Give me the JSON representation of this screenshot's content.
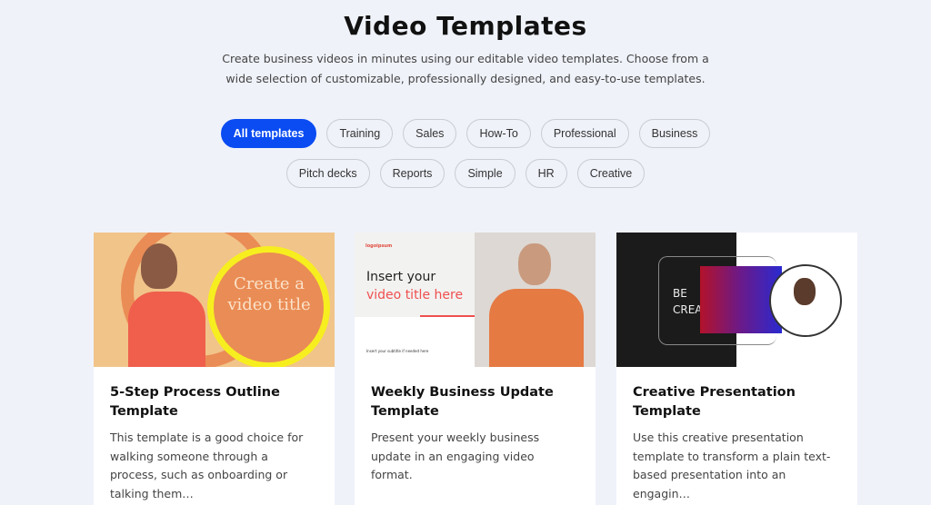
{
  "header": {
    "title": "Video Templates",
    "subtitle": "Create business videos in minutes using our editable video templates. Choose from a wide selection of customizable, professionally designed, and easy-to-use templates."
  },
  "filters": {
    "row1": [
      "All templates",
      "Training",
      "Sales",
      "How-To",
      "Professional",
      "Business"
    ],
    "row2": [
      "Pitch decks",
      "Reports",
      "Simple",
      "HR",
      "Creative"
    ],
    "active": "All templates"
  },
  "cards": [
    {
      "title": "5-Step Process Outline Template",
      "description": "This template is a good choice for walking someone through a process, such as onboarding or talking them…",
      "thumb_text": "Create a video title"
    },
    {
      "title": "Weekly Business Update Template",
      "description": "Present your weekly business update in an engaging video format.",
      "thumb_logo": "logoipsum",
      "thumb_line1": "Insert your",
      "thumb_line2": "video title here",
      "thumb_subtitle": "Insert your subtitle if needed here"
    },
    {
      "title": "Creative Presentation Template",
      "description": "Use this creative presentation template to transform a plain text-based presentation into an engagin…",
      "thumb_line1": "BE",
      "thumb_line2": "CREATIVE"
    }
  ],
  "colors": {
    "accent": "#0b4cf2",
    "background": "#eff2f9"
  }
}
